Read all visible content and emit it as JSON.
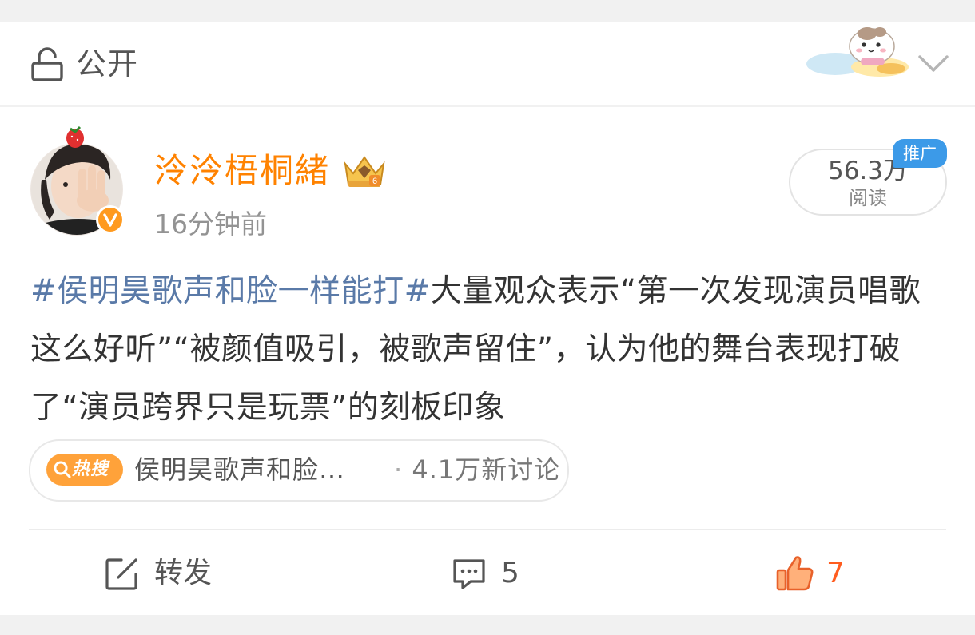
{
  "visibility": {
    "label": "公开",
    "icon": "lock-open-icon"
  },
  "author": {
    "name": "泠泠梧桐緒",
    "name_color": "#ff8200",
    "verified": true,
    "badge_icon": "crown-icon",
    "time": "16分钟前"
  },
  "reads": {
    "count": "56.3万",
    "label": "阅读",
    "promo": "推广"
  },
  "post": {
    "hashtag": "#侯明昊歌声和脸一样能打#",
    "text": "大量观众表示“第一次发现演员唱歌这么好听”“被颜值吸引，被歌声留住”，认为他的舞台表现打破了“演员跨界只是玩票”的刻板印象"
  },
  "trend": {
    "badge": "热搜",
    "title": "侯明昊歌声和脸…",
    "separator": "·",
    "count": "4.1万新讨论"
  },
  "actions": {
    "repost_label": "转发",
    "comment_count": "5",
    "like_count": "7",
    "like_color": "#ff5c1f"
  }
}
